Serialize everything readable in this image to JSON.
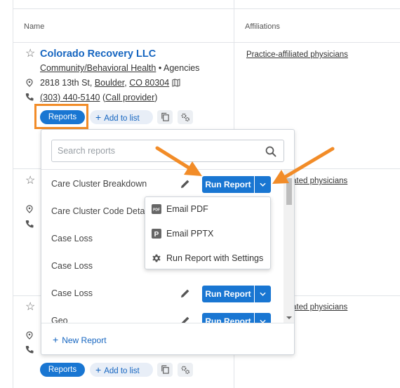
{
  "table": {
    "headers": {
      "name": "Name",
      "affiliations": "Affiliations"
    }
  },
  "provider": {
    "name": "Colorado Recovery LLC",
    "type_link": "Community/Behavioral Health",
    "type_sep": " • ",
    "type_rest": "Agencies",
    "address_street": "2818 13th St, ",
    "address_city": "Boulder",
    "address_sep": ", ",
    "address_state_zip": "CO 80304",
    "phone": "(303) 440-5140",
    "call_link": "Call provider",
    "call_open": " (",
    "call_close": ")"
  },
  "rows": {
    "affiliation_full": "Practice-affiliated physicians",
    "affiliation_partial": "ated physicians"
  },
  "actions": {
    "reports_label": "Reports",
    "add_to_list_label": "Add to list",
    "plus_glyph": "+"
  },
  "reports_panel": {
    "search_placeholder": "Search reports",
    "run_label": "Run Report",
    "new_report_label": "New Report",
    "items": [
      {
        "name": "Care Cluster Breakdown"
      },
      {
        "name": "Care Cluster Code Deta"
      },
      {
        "name": "Case Loss"
      },
      {
        "name": "Case Loss"
      },
      {
        "name": "Case Loss"
      },
      {
        "name": "Geo"
      }
    ]
  },
  "run_menu": {
    "items": [
      {
        "label": "Email PDF",
        "icon": "pdf-icon"
      },
      {
        "label": "Email PPTX",
        "icon": "pptx-icon"
      },
      {
        "label": "Run Report with Settings",
        "icon": "gear-icon"
      }
    ],
    "pdf_badge": "PDF",
    "pptx_badge": "P"
  },
  "colors": {
    "primary": "#1976d2",
    "link": "#1565c0",
    "highlight": "#f28c28"
  }
}
